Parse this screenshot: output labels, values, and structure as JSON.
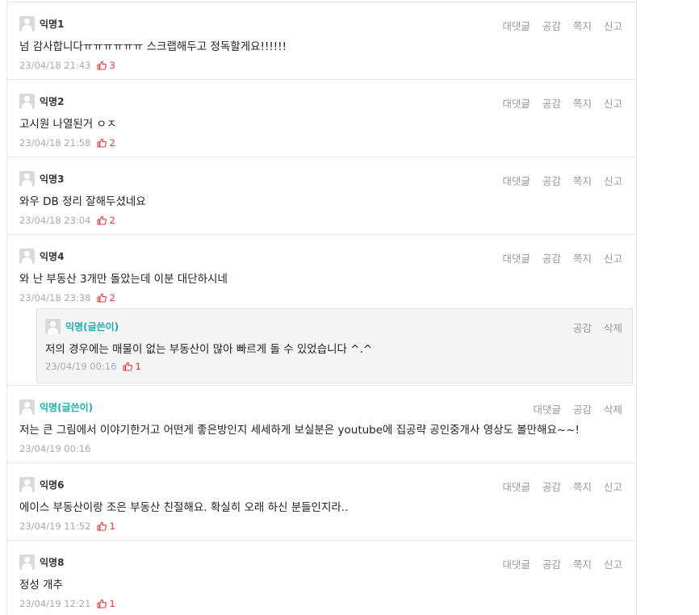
{
  "comments": [
    {
      "nick": "익명1",
      "body": "넘 감사합니다ㅠㅠㅠㅠㅠㅠ 스크랩해두고 정독할게요!!!!!!",
      "date": "23/04/18 21:43",
      "likes": "3",
      "actions": [
        "대댓글",
        "공감",
        "쪽지",
        "신고"
      ]
    },
    {
      "nick": "익명2",
      "body": "고시원 나열된거 ㅇㅈ",
      "date": "23/04/18 21:58",
      "likes": "2",
      "actions": [
        "대댓글",
        "공감",
        "쪽지",
        "신고"
      ]
    },
    {
      "nick": "익명3",
      "body": "와우 DB 정리 잘해두셨네요",
      "date": "23/04/18 23:04",
      "likes": "2",
      "actions": [
        "대댓글",
        "공감",
        "쪽지",
        "신고"
      ]
    },
    {
      "nick": "익명4",
      "body": "와 난 부동산 3개만 돌았는데 이분 대단하시네",
      "date": "23/04/18 23:38",
      "likes": "2",
      "actions": [
        "대댓글",
        "공감",
        "쪽지",
        "신고"
      ]
    },
    {
      "nick": "익명(글쓴이)",
      "body": "저는 큰 그림에서 이야기한거고 어떤게 좋은방인지 세세하게 보실분은 youtube에 집공략 공인중개사 영상도 볼만해요~~!",
      "date": "23/04/19 00:16",
      "likes": "",
      "actions": [
        "대댓글",
        "공감",
        "삭제"
      ]
    },
    {
      "nick": "익명6",
      "body": "에이스 부동산이랑 조은 부동산 친절해요. 확실히 오래 하신 분들인지라..",
      "date": "23/04/19 11:52",
      "likes": "1",
      "actions": [
        "대댓글",
        "공감",
        "쪽지",
        "신고"
      ]
    },
    {
      "nick": "익명8",
      "body": "정성 개추",
      "date": "23/04/19 12:21",
      "likes": "1",
      "actions": [
        "대댓글",
        "공감",
        "쪽지",
        "신고"
      ]
    }
  ],
  "reply": {
    "nick": "익명(글쓴이)",
    "body": "저의 경우에는 매물이 없는 부동산이 많아 빠르게 돌 수 있었습니다 ^.^",
    "date": "23/04/19 00:16",
    "likes": "1",
    "actions": [
      "공감",
      "삭제"
    ]
  },
  "colors": {
    "like": "#e03a3a",
    "writer": "#1ab0b0",
    "muted": "#999999"
  },
  "icons": {
    "avatar": "default-avatar-icon",
    "like": "thumbs-up-icon"
  }
}
